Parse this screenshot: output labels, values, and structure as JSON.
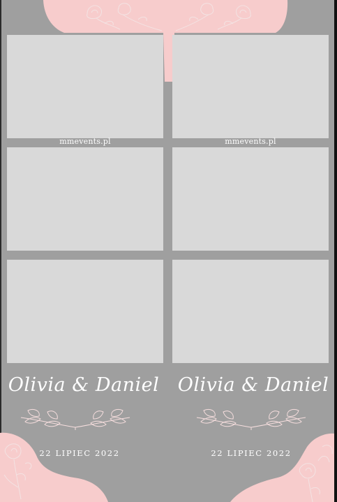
{
  "colors": {
    "background_gray": "#9f9f9f",
    "photo_slot": "#d9d9d9",
    "accent_pink": "#f7cccc",
    "floral_line": "#f3e3e3",
    "text": "#ffffff"
  },
  "columns": [
    {
      "watermark": "mmevents.pl",
      "names": "Olivia & Daniel",
      "date": "22 LIPIEC 2022"
    },
    {
      "watermark": "mmevents.pl",
      "names": "Olivia & Daniel",
      "date": "22 LIPIEC 2022"
    }
  ],
  "icons": {
    "laurel": "laurel-branch-icon",
    "flower": "rose-outline-icon"
  }
}
